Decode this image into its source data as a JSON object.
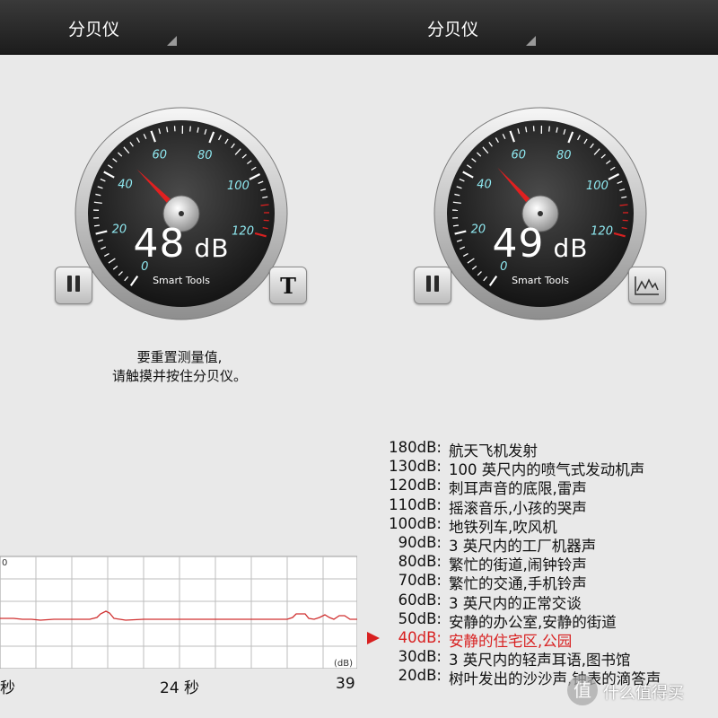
{
  "left": {
    "title": "分贝仪",
    "reading": {
      "value": "48",
      "unit": "dB"
    },
    "brand": "Smart Tools",
    "needle_db": 48,
    "hint": [
      "要重置测量值,",
      "请触摸并按住分贝仪。"
    ],
    "xlabels": [
      "秒",
      "24 秒",
      "39"
    ],
    "graph_unit": "(dB)",
    "graph_y_top": "0"
  },
  "right": {
    "title": "分贝仪",
    "reading": {
      "value": "49",
      "unit": "dB"
    },
    "brand": "Smart Tools",
    "needle_db": 49,
    "reference": [
      {
        "db": "180dB:",
        "desc": "航天飞机发射"
      },
      {
        "db": "130dB:",
        "desc": "100 英尺内的喷气式发动机声"
      },
      {
        "db": "120dB:",
        "desc": "刺耳声音的底限,雷声"
      },
      {
        "db": "110dB:",
        "desc": "摇滚音乐,小孩的哭声"
      },
      {
        "db": "100dB:",
        "desc": "地铁列车,吹风机"
      },
      {
        "db": "90dB:",
        "desc": "3 英尺内的工厂机器声"
      },
      {
        "db": "80dB:",
        "desc": "繁忙的街道,闹钟铃声"
      },
      {
        "db": "70dB:",
        "desc": "繁忙的交通,手机铃声"
      },
      {
        "db": "60dB:",
        "desc": "3 英尺内的正常交谈"
      },
      {
        "db": "50dB:",
        "desc": "安静的办公室,安静的街道"
      },
      {
        "db": "40dB:",
        "desc": "安静的住宅区,公园"
      },
      {
        "db": "30dB:",
        "desc": "3 英尺内的轻声耳语,图书馆"
      },
      {
        "db": "20dB:",
        "desc": "树叶发出的沙沙声,钟表的滴答声"
      }
    ],
    "highlight_index": 10
  },
  "gauge_scale": {
    "labels": [
      "0",
      "20",
      "40",
      "60",
      "80",
      "100",
      "120"
    ],
    "min": 0,
    "max": 120
  },
  "watermark": {
    "text": "什么值得买"
  },
  "colors": {
    "accent_red": "#d82020",
    "tick_cyan": "#8fe8f0",
    "graph_line": "#d03030"
  }
}
